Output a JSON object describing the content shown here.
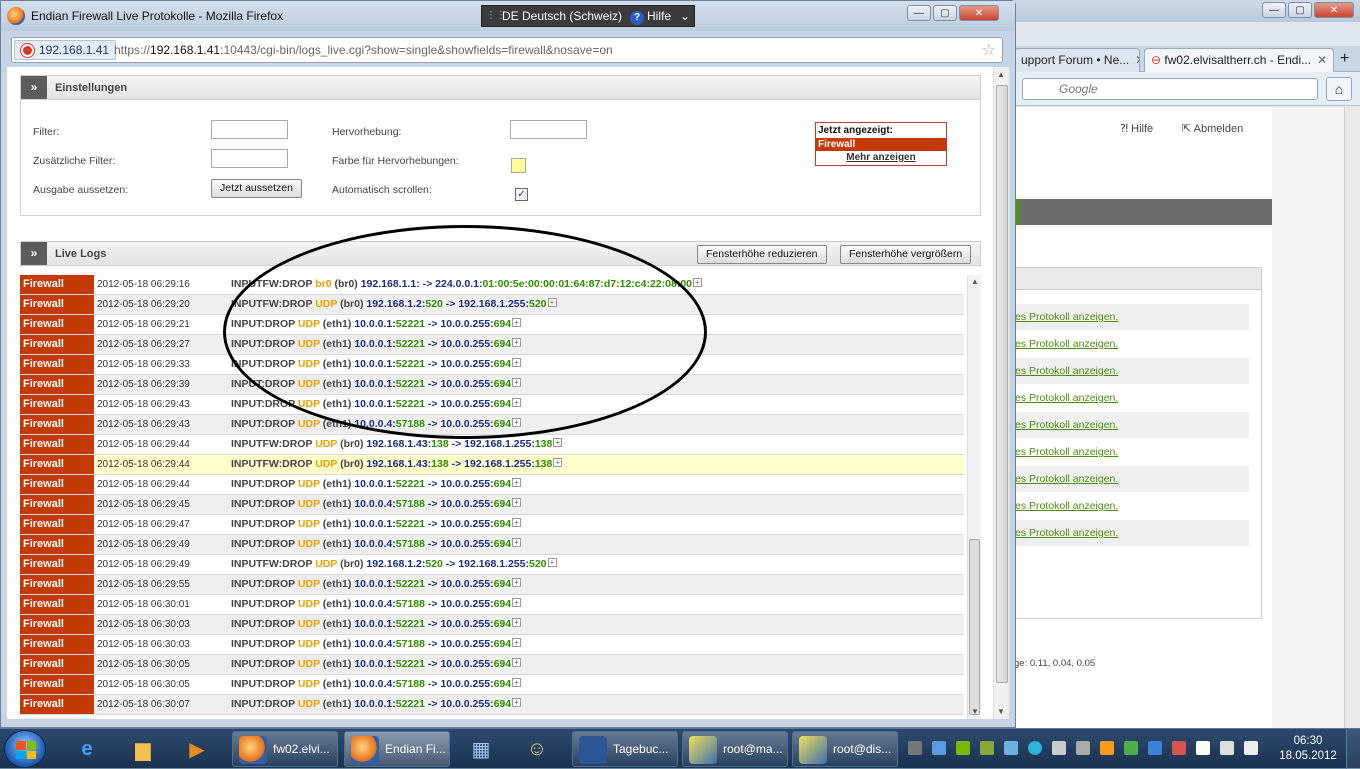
{
  "background_window": {
    "tabs": [
      {
        "label": "upport Forum • Ne..."
      },
      {
        "label": "fw02.elvisaltherr.ch - Endi..."
      }
    ],
    "search_placeholder": "Google",
    "help_label": "Hilfe",
    "logout_label": "Abmelden",
    "protocol_links": [
      "es Protokoll anzeigen.",
      "es Protokoll anzeigen.",
      "es Protokoll anzeigen.",
      "es Protokoll anzeigen.",
      "es Protokoll anzeigen.",
      "es Protokoll anzeigen.",
      "es Protokoll anzeigen.",
      "es Protokoll anzeigen.",
      "es Protokoll anzeigen."
    ],
    "load_text": "ge: 0.11, 0.04, 0.05"
  },
  "window": {
    "title": "Endian Firewall Live Protokolle - Mozilla Firefox",
    "language": "DE Deutsch (Schweiz)",
    "help": "Hilfe",
    "url_site": "192.168.1.41",
    "url_prefix": "https://",
    "url_host": "192.168.1.41",
    "url_rest": ":10443/cgi-bin/logs_live.cgi?show=single&showfields=firewall&nosave=on"
  },
  "settings": {
    "title": "Einstellungen",
    "filter_label": "Filter:",
    "extra_filter_label": "Zusätzliche Filter:",
    "pause_label": "Ausgabe aussetzen:",
    "pause_button": "Jetzt aussetzen",
    "highlight_label": "Hervorhebung:",
    "highlight_color_label": "Farbe für Hervorhebungen:",
    "autoscroll_label": "Automatisch scrollen:",
    "autoscroll_checked": true,
    "highlight_color": "#ffff99",
    "shown_title": "Jetzt angezeigt:",
    "shown_item": "Firewall",
    "more_label": "Mehr anzeigen"
  },
  "live_logs": {
    "title": "Live Logs",
    "reduce_button": "Fensterhöhe reduzieren",
    "enlarge_button": "Fensterhöhe vergrößern",
    "rows": [
      {
        "tag": "Firewall",
        "ts": "2012-05-18 06:29:16",
        "chain": "INPUTFW:DROP ",
        "proto": "br0",
        "iface": " (br0) ",
        "src": "192.168.1.1:",
        "sport": "",
        "arrow": " -> ",
        "dst": "224.0.0.1:",
        "dport": "01:00:5e:00:00:01:64:87:d7:12:c4:22:08:00"
      },
      {
        "tag": "Firewall",
        "ts": "2012-05-18 06:29:20",
        "chain": "INPUTFW:DROP ",
        "proto": "UDP",
        "iface": " (br0) ",
        "src": "192.168.1.2:",
        "sport": "520",
        "arrow": " -> ",
        "dst": "192.168.1.255:",
        "dport": "520"
      },
      {
        "tag": "Firewall",
        "ts": "2012-05-18 06:29:21",
        "chain": "INPUT:DROP ",
        "proto": "UDP",
        "iface": " (eth1) ",
        "src": "10.0.0.1:",
        "sport": "52221",
        "arrow": " -> ",
        "dst": "10.0.0.255:",
        "dport": "694"
      },
      {
        "tag": "Firewall",
        "ts": "2012-05-18 06:29:27",
        "chain": "INPUT:DROP ",
        "proto": "UDP",
        "iface": " (eth1) ",
        "src": "10.0.0.1:",
        "sport": "52221",
        "arrow": " -> ",
        "dst": "10.0.0.255:",
        "dport": "694"
      },
      {
        "tag": "Firewall",
        "ts": "2012-05-18 06:29:33",
        "chain": "INPUT:DROP ",
        "proto": "UDP",
        "iface": " (eth1) ",
        "src": "10.0.0.1:",
        "sport": "52221",
        "arrow": " -> ",
        "dst": "10.0.0.255:",
        "dport": "694"
      },
      {
        "tag": "Firewall",
        "ts": "2012-05-18 06:29:39",
        "chain": "INPUT:DROP ",
        "proto": "UDP",
        "iface": " (eth1) ",
        "src": "10.0.0.1:",
        "sport": "52221",
        "arrow": " -> ",
        "dst": "10.0.0.255:",
        "dport": "694"
      },
      {
        "tag": "Firewall",
        "ts": "2012-05-18 06:29:43",
        "chain": "INPUT:DROP ",
        "proto": "UDP",
        "iface": " (eth1) ",
        "src": "10.0.0.1:",
        "sport": "52221",
        "arrow": " -> ",
        "dst": "10.0.0.255:",
        "dport": "694"
      },
      {
        "tag": "Firewall",
        "ts": "2012-05-18 06:29:43",
        "chain": "INPUT:DROP ",
        "proto": "UDP",
        "iface": " (eth1) ",
        "src": "10.0.0.4:",
        "sport": "57188",
        "arrow": " -> ",
        "dst": "10.0.0.255:",
        "dport": "694"
      },
      {
        "tag": "Firewall",
        "ts": "2012-05-18 06:29:44",
        "chain": "INPUTFW:DROP ",
        "proto": "UDP",
        "iface": " (br0) ",
        "src": "192.168.1.43:",
        "sport": "138",
        "arrow": " -> ",
        "dst": "192.168.1.255:",
        "dport": "138"
      },
      {
        "tag": "Firewall",
        "ts": "2012-05-18 06:29:44",
        "chain": "INPUTFW:DROP ",
        "proto": "UDP",
        "iface": " (br0) ",
        "src": "192.168.1.43:",
        "sport": "138",
        "arrow": " -> ",
        "dst": "192.168.1.255:",
        "dport": "138",
        "highlight": true
      },
      {
        "tag": "Firewall",
        "ts": "2012-05-18 06:29:44",
        "chain": "INPUT:DROP ",
        "proto": "UDP",
        "iface": " (eth1) ",
        "src": "10.0.0.1:",
        "sport": "52221",
        "arrow": " -> ",
        "dst": "10.0.0.255:",
        "dport": "694"
      },
      {
        "tag": "Firewall",
        "ts": "2012-05-18 06:29:45",
        "chain": "INPUT:DROP ",
        "proto": "UDP",
        "iface": " (eth1) ",
        "src": "10.0.0.4:",
        "sport": "57188",
        "arrow": " -> ",
        "dst": "10.0.0.255:",
        "dport": "694"
      },
      {
        "tag": "Firewall",
        "ts": "2012-05-18 06:29:47",
        "chain": "INPUT:DROP ",
        "proto": "UDP",
        "iface": " (eth1) ",
        "src": "10.0.0.1:",
        "sport": "52221",
        "arrow": " -> ",
        "dst": "10.0.0.255:",
        "dport": "694"
      },
      {
        "tag": "Firewall",
        "ts": "2012-05-18 06:29:49",
        "chain": "INPUT:DROP ",
        "proto": "UDP",
        "iface": " (eth1) ",
        "src": "10.0.0.4:",
        "sport": "57188",
        "arrow": " -> ",
        "dst": "10.0.0.255:",
        "dport": "694"
      },
      {
        "tag": "Firewall",
        "ts": "2012-05-18 06:29:49",
        "chain": "INPUTFW:DROP ",
        "proto": "UDP",
        "iface": " (br0) ",
        "src": "192.168.1.2:",
        "sport": "520",
        "arrow": " -> ",
        "dst": "192.168.1.255:",
        "dport": "520"
      },
      {
        "tag": "Firewall",
        "ts": "2012-05-18 06:29:55",
        "chain": "INPUT:DROP ",
        "proto": "UDP",
        "iface": " (eth1) ",
        "src": "10.0.0.1:",
        "sport": "52221",
        "arrow": " -> ",
        "dst": "10.0.0.255:",
        "dport": "694"
      },
      {
        "tag": "Firewall",
        "ts": "2012-05-18 06:30:01",
        "chain": "INPUT:DROP ",
        "proto": "UDP",
        "iface": " (eth1) ",
        "src": "10.0.0.4:",
        "sport": "57188",
        "arrow": " -> ",
        "dst": "10.0.0.255:",
        "dport": "694"
      },
      {
        "tag": "Firewall",
        "ts": "2012-05-18 06:30:03",
        "chain": "INPUT:DROP ",
        "proto": "UDP",
        "iface": " (eth1) ",
        "src": "10.0.0.1:",
        "sport": "52221",
        "arrow": " -> ",
        "dst": "10.0.0.255:",
        "dport": "694"
      },
      {
        "tag": "Firewall",
        "ts": "2012-05-18 06:30:03",
        "chain": "INPUT:DROP ",
        "proto": "UDP",
        "iface": " (eth1) ",
        "src": "10.0.0.4:",
        "sport": "57188",
        "arrow": " -> ",
        "dst": "10.0.0.255:",
        "dport": "694"
      },
      {
        "tag": "Firewall",
        "ts": "2012-05-18 06:30:05",
        "chain": "INPUT:DROP ",
        "proto": "UDP",
        "iface": " (eth1) ",
        "src": "10.0.0.1:",
        "sport": "52221",
        "arrow": " -> ",
        "dst": "10.0.0.255:",
        "dport": "694"
      },
      {
        "tag": "Firewall",
        "ts": "2012-05-18 06:30:05",
        "chain": "INPUT:DROP ",
        "proto": "UDP",
        "iface": " (eth1) ",
        "src": "10.0.0.4:",
        "sport": "57188",
        "arrow": " -> ",
        "dst": "10.0.0.255:",
        "dport": "694"
      },
      {
        "tag": "Firewall",
        "ts": "2012-05-18 06:30:07",
        "chain": "INPUT:DROP ",
        "proto": "UDP",
        "iface": " (eth1) ",
        "src": "10.0.0.1:",
        "sport": "52221",
        "arrow": " -> ",
        "dst": "10.0.0.255:",
        "dport": "694"
      }
    ]
  },
  "taskbar": {
    "buttons": [
      {
        "label": "fw02.elvi...",
        "icon": "firefox-icon"
      },
      {
        "label": "Endian Fi...",
        "icon": "firefox-icon",
        "active": true
      },
      {
        "label": "Tagebuc...",
        "icon": "word-icon"
      },
      {
        "label": "root@ma...",
        "icon": "putty-icon"
      },
      {
        "label": "root@dis...",
        "icon": "putty-icon"
      }
    ],
    "time": "06:30",
    "date": "18.05.2012"
  }
}
